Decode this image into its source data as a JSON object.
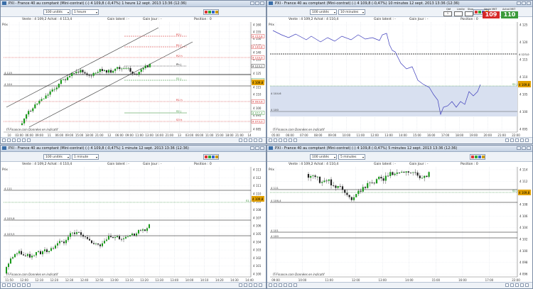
{
  "colors": {
    "up": "#1a9a1a",
    "down": "#222222",
    "resist": "#d22020",
    "support": "#2a8a2a",
    "line": "#3d3dbb",
    "band": "#d8e0f0",
    "sellBtn": "#d62828",
    "buyBtn": "#3a9a3a"
  },
  "panels": [
    {
      "key": "p1",
      "title": "PXI - France 40 au comptant (Mini-contrat)   (-)    4 109,8 (-0,47%)    1 heure   12 sept. 2013 13:36 (12:36)",
      "units": "100 unités",
      "timeframe": "1 heure",
      "infoLeft": "Vente : 4 109,2  Achat : 4 113,4",
      "infoMid": "Gain latent : -",
      "infoMid2": "Gain Jour : -",
      "infoRight": "Position : 0",
      "sub": "Prix",
      "source": "IT-Finance.com  Données en indicatif",
      "yTicks": [
        "4 160",
        "4 155",
        "4 150",
        "4 145",
        "4 140",
        "4 135",
        "4 130",
        "4 125",
        "4 120",
        "4 115",
        "4 110",
        "4 105",
        "4 100",
        "4 095",
        "4 090",
        "4 085"
      ],
      "leftTags": [
        "4 115",
        "4 104"
      ],
      "levels": [
        {
          "label": "R2 j",
          "value": "4 153,8"
        },
        {
          "label": "R1 f",
          "value": "4 140,8"
        },
        {
          "label": "R2 h",
          "value": "4 129,9"
        },
        {
          "label": "Ph j",
          "value": "4 123,1"
        },
        {
          "label": "S1 j",
          "value": "4 109,2"
        },
        {
          "label": "R1 h",
          "value": "4 093,6"
        },
        {
          "label": "S2 j",
          "value": "4 077,4"
        },
        {
          "label": "S3 h",
          "value": "4 073,0"
        }
      ],
      "currentPrice": "4 109,8",
      "xTicks": [
        "10",
        "03:00",
        "06:00",
        "09:00",
        "11",
        "06:00",
        "09:00",
        "15:00",
        "18:00",
        "21:00",
        "12",
        "06:00",
        "09:00",
        "11:00",
        "13:00",
        "16:00",
        "21:00",
        "13",
        "03:00",
        "06:00",
        "11:00",
        "15:00",
        "18:00",
        "21:00",
        "14"
      ]
    },
    {
      "key": "p2",
      "title": "PXI - France 40 au comptant (Mini-contrat)   (-)    4 109,8 (-0,47%)    10 minutes   12 sept. 2013 13:36 (12:36)",
      "units": "100 unités",
      "timeframe": "10 minutes",
      "infoLeft": "Vente : 4 109,2  Achat : 4 110,4",
      "infoMid": "Gain latent : -",
      "infoMid2": "Gain Jour : -",
      "infoRight": "Position : 0",
      "sub": "Prix",
      "source": "IT-Finance.com  Données en indicatif",
      "qtyLabel": "Qté",
      "limitLabel": "Limite",
      "stopLabel": "Stop",
      "sellLabel": "Vente MKT",
      "buyLabel": "Achat MKT",
      "sellPrice": "109",
      "buyPrice": "110",
      "qtyValue": "1",
      "yTicks": [
        "4 125",
        "4 120",
        "4 115",
        "4 110",
        "4 105",
        "4 100",
        "4 095"
      ],
      "leftTags": [
        "4 104.6",
        "4 100"
      ],
      "levels": [
        {
          "label": "S1 j",
          "value": "4 109,2"
        },
        {
          "label": "",
          "value": "4 123,0"
        }
      ],
      "currentPrice": "4 109,8",
      "xTicks": [
        "05:00",
        "06:00",
        "07:00",
        "08:00",
        "09:00",
        "10:00",
        "11:00",
        "12:00",
        "13:00",
        "14:00",
        "15:00",
        "16:00",
        "17:00",
        "18:00",
        "19:00",
        "20:00",
        "21:00",
        "22:00"
      ]
    },
    {
      "key": "p3",
      "title": "PXI - France 40 au comptant (Mini-contrat)   (-)    4 109,8 (-0,47%)    1 minute   12 sept. 2013 13:36 (12:36)",
      "units": "100 unités",
      "timeframe": "1 minute",
      "infoLeft": "Vente : 4 109,2  Achat : 4 110,4",
      "infoMid": "Gain latent : -",
      "infoMid2": "Gain Jour : -",
      "infoRight": "Position : 0",
      "sub": "Prix",
      "source": "IT-Finance.com  Données en indicatif",
      "yTicks": [
        "4 113",
        "4 112",
        "4 111",
        "4 110",
        "4 109",
        "4 108",
        "4 107",
        "4 106",
        "4 105",
        "4 104",
        "4 103",
        "4 102",
        "4 101",
        "4 100"
      ],
      "leftTags": [
        "4 111",
        "4 105,8",
        "4 103,5"
      ],
      "levels": [
        {
          "label": "S1 j",
          "value": "4 109,2"
        }
      ],
      "currentPrice": "4 109,8",
      "xTicks": [
        "11:50",
        "12:00",
        "12:10",
        "12:20",
        "12:30",
        "12:40",
        "12:50",
        "13:00",
        "13:10",
        "13:20",
        "13:30",
        "13:40",
        "14:00",
        "14:10",
        "14:20",
        "14:30",
        "14:40"
      ]
    },
    {
      "key": "p4",
      "title": "PXI - France 40 au comptant (Mini-contrat)   (-)    4 109,8 (-0,47%)    5 minutes   12 sept. 2013 13:36 (12:36)",
      "units": "100 unités",
      "timeframe": "5 minutes",
      "infoLeft": "Vente : 4 109,2  Achat : 4 110,4",
      "infoMid": "Gain latent : -",
      "infoMid2": "Gain Jour : -",
      "infoRight": "Position : 0",
      "sub": "Prix",
      "source": "IT-Finance.com  Données en indicatif",
      "yTicks": [
        "4 114",
        "4 112",
        "4 110",
        "4 108",
        "4 106",
        "4 104",
        "4 102",
        "4 100",
        "4 098",
        "4 096"
      ],
      "leftTags": [
        "4 111",
        "4 106,4",
        "4 101",
        "4 100"
      ],
      "levels": [
        {
          "label": "S1 j",
          "value": "4 109,2"
        }
      ],
      "currentPrice": "4 109,8",
      "xTicks": [
        "09:00",
        "10:00",
        "11:00",
        "12:00",
        "13:00",
        "14:00",
        "15:00",
        "16:00",
        "17:00",
        "22:00"
      ]
    }
  ]
}
